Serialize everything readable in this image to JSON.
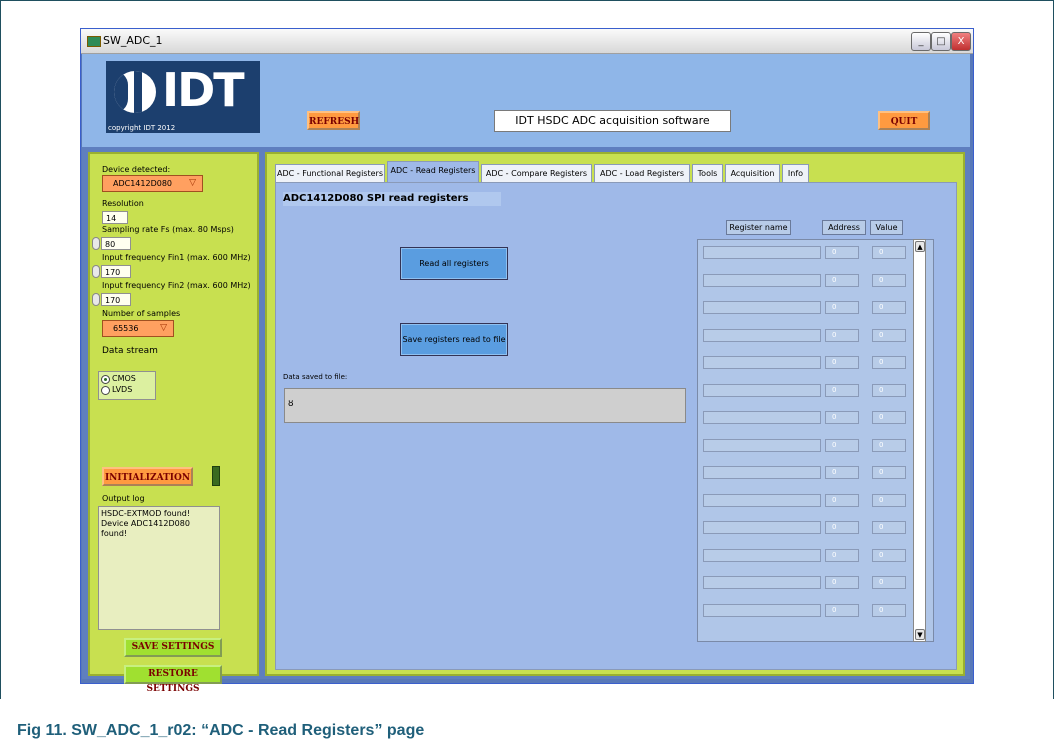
{
  "window": {
    "title": "SW_ADC_1",
    "minimize": "_",
    "maximize": "□",
    "close": "X"
  },
  "logo": {
    "text": "IDT",
    "copyright": "copyright IDT 2012"
  },
  "header": {
    "refresh_label": "REFRESH",
    "app_title": "IDT  HSDC ADC acquisition software",
    "quit_label": "QUIT"
  },
  "sidebar": {
    "device_label": "Device detected:",
    "device_value": "ADC1412D080",
    "resolution_label": "Resolution",
    "resolution_value": "14",
    "sampling_label": "Sampling rate Fs (max. 80 Msps)",
    "sampling_value": "80",
    "fin1_label": "Input frequency Fin1 (max. 600 MHz)",
    "fin1_value": "170",
    "fin2_label": "Input frequency Fin2 (max. 600 MHz)",
    "fin2_value": "170",
    "samples_label": "Number of samples",
    "samples_value": "65536",
    "datastream_label": "Data stream",
    "datastream_options": [
      "CMOS",
      "LVDS"
    ],
    "datastream_selected": "CMOS",
    "init_label": "INITIALIZATION",
    "output_log_label": "Output log",
    "output_log_lines": [
      "HSDC-EXTMOD found!",
      "Device ADC1412D080 found!"
    ],
    "save_settings_label": "SAVE SETTINGS",
    "restore_settings_label": "RESTORE SETTINGS"
  },
  "tabs": [
    "ADC - Functional Registers",
    "ADC - Read Registers",
    "ADC - Compare Registers",
    "ADC - Load Registers",
    "Tools",
    "Acquisition",
    "Info"
  ],
  "active_tab": "ADC - Read Registers",
  "panel": {
    "heading": "ADC1412D080 SPI read registers",
    "read_all_label": "Read all registers",
    "save_read_label": "Save registers read to file",
    "data_saved_label": "Data saved to file:",
    "data_saved_value": "",
    "col_register_name": "Register name",
    "col_address": "Address",
    "col_value": "Value",
    "rows": [
      {
        "name": "",
        "address": "0",
        "value": "0"
      },
      {
        "name": "",
        "address": "0",
        "value": "0"
      },
      {
        "name": "",
        "address": "0",
        "value": "0"
      },
      {
        "name": "",
        "address": "0",
        "value": "0"
      },
      {
        "name": "",
        "address": "0",
        "value": "0"
      },
      {
        "name": "",
        "address": "0",
        "value": "0"
      },
      {
        "name": "",
        "address": "0",
        "value": "0"
      },
      {
        "name": "",
        "address": "0",
        "value": "0"
      },
      {
        "name": "",
        "address": "0",
        "value": "0"
      },
      {
        "name": "",
        "address": "0",
        "value": "0"
      },
      {
        "name": "",
        "address": "0",
        "value": "0"
      },
      {
        "name": "",
        "address": "0",
        "value": "0"
      },
      {
        "name": "",
        "address": "0",
        "value": "0"
      },
      {
        "name": "",
        "address": "0",
        "value": "0"
      }
    ]
  },
  "caption": "Fig 11.  SW_ADC_1_r02: “ADC - Read Registers” page",
  "colors": {
    "accent_orange": "#ff9a40",
    "panel_green": "#c8e050",
    "panel_blue": "#9fb9e8",
    "caption_teal": "#1f5f7a"
  }
}
